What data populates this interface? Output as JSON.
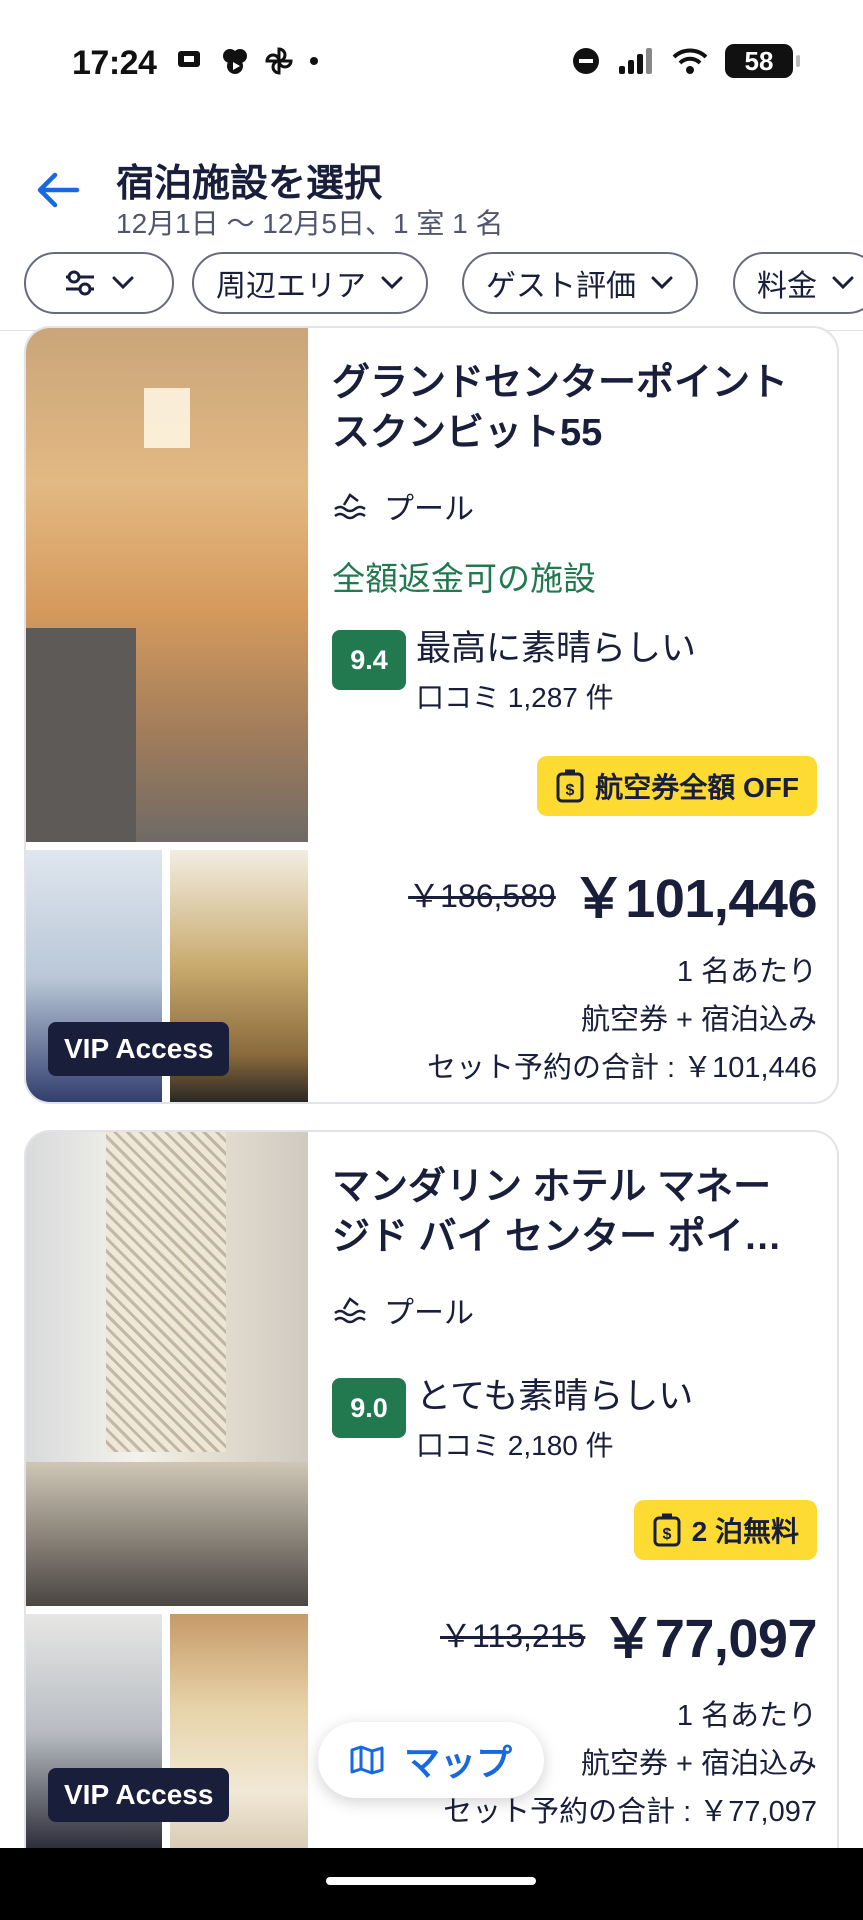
{
  "status_bar": {
    "time": "17:24",
    "battery": "58"
  },
  "header": {
    "title": "宿泊施設を選択",
    "subtitle": "12月1日 〜 12月5日、1 室 1 名"
  },
  "filters": [
    {
      "label": ""
    },
    {
      "label": "周辺エリア"
    },
    {
      "label": "ゲスト評価"
    },
    {
      "label": "料金"
    }
  ],
  "hotels": [
    {
      "name_line1": "グランドセンターポイント",
      "name_line2": "スクンビット55",
      "amenity": "プール",
      "refund": "全額返金可の施設",
      "score": "9.4",
      "rating_label": "最高に素晴らしい",
      "reviews": "口コミ 1,287 件",
      "deal": "航空券全額 OFF",
      "old_price": "￥186,589",
      "price": "￥101,446",
      "per_person": "1 名あたり",
      "includes": "航空券 + 宿泊込み",
      "total": "セット予約の合計 : ￥101,446",
      "badge": "VIP Access"
    },
    {
      "name_line1": "マンダリン ホテル マネー",
      "name_line2": "ジド バイ センター ポイ…",
      "amenity": "プール",
      "score": "9.0",
      "rating_label": "とても素晴らしい",
      "reviews": "口コミ 2,180 件",
      "deal": "2 泊無料",
      "old_price": "￥113,215",
      "price": "￥77,097",
      "per_person": "1 名あたり",
      "includes": "航空券 + 宿泊込み",
      "total": "セット予約の合計 : ￥77,097",
      "badge": "VIP Access"
    }
  ],
  "map_button": {
    "label": "マップ"
  },
  "colors": {
    "accent": "#1668e3",
    "rating_green": "#227950",
    "deal_yellow": "#fddb32",
    "navy": "#191e3b"
  }
}
